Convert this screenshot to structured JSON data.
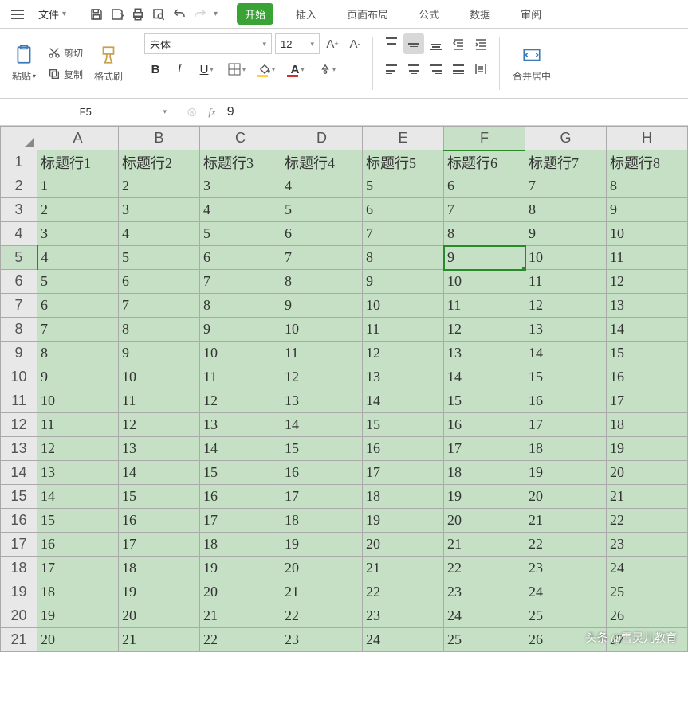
{
  "menubar": {
    "file_label": "文件",
    "tabs": [
      {
        "label": "开始",
        "active": true
      },
      {
        "label": "插入",
        "active": false
      },
      {
        "label": "页面布局",
        "active": false
      },
      {
        "label": "公式",
        "active": false
      },
      {
        "label": "数据",
        "active": false
      },
      {
        "label": "审阅",
        "active": false
      }
    ]
  },
  "ribbon": {
    "paste_label": "粘贴",
    "cut_label": "剪切",
    "copy_label": "复制",
    "format_painter_label": "格式刷",
    "font_name": "宋体",
    "font_size": "12",
    "merge_center_label": "合并居中"
  },
  "formula_bar": {
    "name_box": "F5",
    "fx_label": "fx",
    "value": "9"
  },
  "sheet": {
    "columns": [
      "A",
      "B",
      "C",
      "D",
      "E",
      "F",
      "G",
      "H"
    ],
    "active_col": "F",
    "active_row": 5,
    "headers": [
      "标题行1",
      "标题行2",
      "标题行3",
      "标题行4",
      "标题行5",
      "标题行6",
      "标题行7",
      "标题行8"
    ],
    "rows": [
      [
        "1",
        "2",
        "3",
        "4",
        "5",
        "6",
        "7",
        "8"
      ],
      [
        "2",
        "3",
        "4",
        "5",
        "6",
        "7",
        "8",
        "9"
      ],
      [
        "3",
        "4",
        "5",
        "6",
        "7",
        "8",
        "9",
        "10"
      ],
      [
        "4",
        "5",
        "6",
        "7",
        "8",
        "9",
        "10",
        "11"
      ],
      [
        "5",
        "6",
        "7",
        "8",
        "9",
        "10",
        "11",
        "12"
      ],
      [
        "6",
        "7",
        "8",
        "9",
        "10",
        "11",
        "12",
        "13"
      ],
      [
        "7",
        "8",
        "9",
        "10",
        "11",
        "12",
        "13",
        "14"
      ],
      [
        "8",
        "9",
        "10",
        "11",
        "12",
        "13",
        "14",
        "15"
      ],
      [
        "9",
        "10",
        "11",
        "12",
        "13",
        "14",
        "15",
        "16"
      ],
      [
        "10",
        "11",
        "12",
        "13",
        "14",
        "15",
        "16",
        "17"
      ],
      [
        "11",
        "12",
        "13",
        "14",
        "15",
        "16",
        "17",
        "18"
      ],
      [
        "12",
        "13",
        "14",
        "15",
        "16",
        "17",
        "18",
        "19"
      ],
      [
        "13",
        "14",
        "15",
        "16",
        "17",
        "18",
        "19",
        "20"
      ],
      [
        "14",
        "15",
        "16",
        "17",
        "18",
        "19",
        "20",
        "21"
      ],
      [
        "15",
        "16",
        "17",
        "18",
        "19",
        "20",
        "21",
        "22"
      ],
      [
        "16",
        "17",
        "18",
        "19",
        "20",
        "21",
        "22",
        "23"
      ],
      [
        "17",
        "18",
        "19",
        "20",
        "21",
        "22",
        "23",
        "24"
      ],
      [
        "18",
        "19",
        "20",
        "21",
        "22",
        "23",
        "24",
        "25"
      ],
      [
        "19",
        "20",
        "21",
        "22",
        "23",
        "24",
        "25",
        "26"
      ],
      [
        "20",
        "21",
        "22",
        "23",
        "24",
        "25",
        "26",
        "27"
      ]
    ]
  },
  "watermark": "头条 @雪灵儿教育"
}
